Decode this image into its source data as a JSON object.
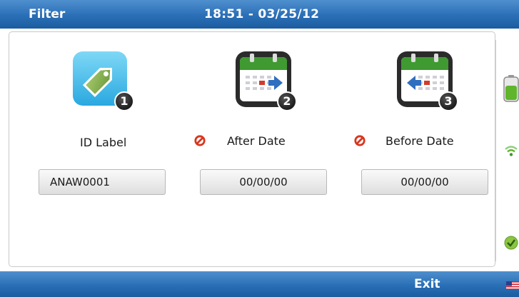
{
  "header": {
    "title": "Filter",
    "clock": "18:51 - 03/25/12"
  },
  "filters": [
    {
      "label": "ID Label",
      "value": "ANAW0001",
      "badge": "1",
      "icon": "tag-icon"
    },
    {
      "label": "After Date",
      "value": "00/00/00",
      "badge": "2",
      "icon": "calendar-forward-icon",
      "status": "disabled-icon"
    },
    {
      "label": "Before Date",
      "value": "00/00/00",
      "badge": "3",
      "icon": "calendar-back-icon",
      "status": "disabled-icon"
    }
  ],
  "side_icons": [
    "battery-icon",
    "wifi-icon",
    "check-icon"
  ],
  "footer": {
    "exit_label": "Exit",
    "language_icon": "us-flag-icon"
  },
  "colors": {
    "bar_blue": "#2a6fb6",
    "tag_blue": "#4fc3ee",
    "calendar_green": "#3a8b2c",
    "disabled_red": "#d9361f"
  }
}
